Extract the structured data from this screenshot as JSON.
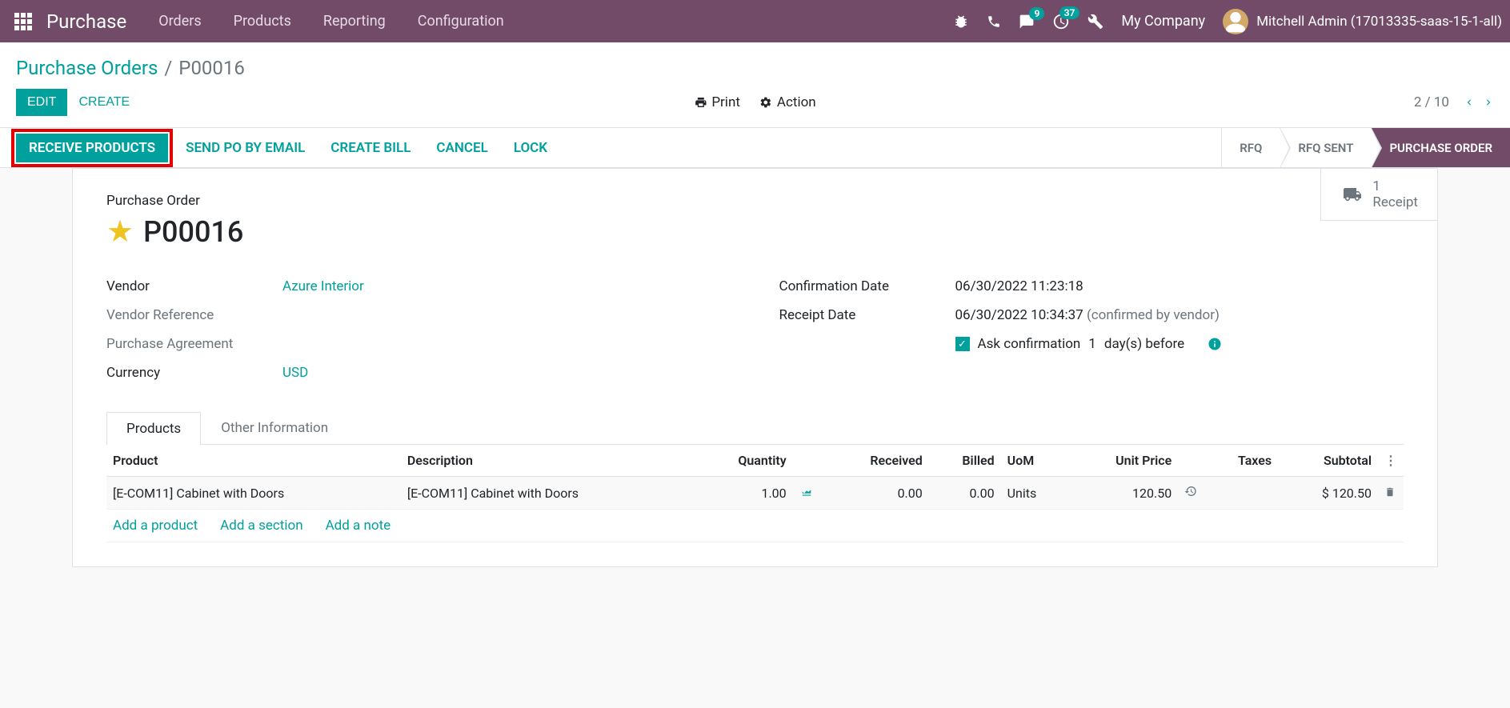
{
  "topnav": {
    "app_name": "Purchase",
    "menu": [
      "Orders",
      "Products",
      "Reporting",
      "Configuration"
    ],
    "msg_badge": "9",
    "activity_badge": "37",
    "company": "My Company",
    "user": "Mitchell Admin (17013335-saas-15-1-all)"
  },
  "breadcrumb": {
    "parent": "Purchase Orders",
    "current": "P00016"
  },
  "control": {
    "edit": "Edit",
    "create": "Create",
    "print": "Print",
    "action": "Action",
    "pager": "2 / 10"
  },
  "statusbar": {
    "buttons": [
      "Receive Products",
      "Send PO by Email",
      "Create Bill",
      "Cancel",
      "Lock"
    ],
    "stages": [
      "RFQ",
      "RFQ SENT",
      "PURCHASE ORDER"
    ]
  },
  "smart": {
    "receipt_count": "1",
    "receipt_label": "Receipt"
  },
  "form": {
    "title_label": "Purchase Order",
    "title_value": "P00016",
    "left": {
      "vendor_label": "Vendor",
      "vendor_value": "Azure Interior",
      "vendor_ref_label": "Vendor Reference",
      "agreement_label": "Purchase Agreement",
      "currency_label": "Currency",
      "currency_value": "USD"
    },
    "right": {
      "confirm_label": "Confirmation Date",
      "confirm_value": "06/30/2022 11:23:18",
      "receipt_label": "Receipt Date",
      "receipt_value": "06/30/2022 10:34:37",
      "receipt_note": "(confirmed by vendor)",
      "ask_confirm": "Ask confirmation",
      "ask_days": "1",
      "ask_suffix": "day(s) before"
    }
  },
  "tabs": [
    "Products",
    "Other Information"
  ],
  "table": {
    "headers": {
      "product": "Product",
      "description": "Description",
      "quantity": "Quantity",
      "received": "Received",
      "billed": "Billed",
      "uom": "UoM",
      "unit_price": "Unit Price",
      "taxes": "Taxes",
      "subtotal": "Subtotal"
    },
    "rows": [
      {
        "product": "[E-COM11] Cabinet with Doors",
        "description": "[E-COM11] Cabinet with Doors",
        "quantity": "1.00",
        "received": "0.00",
        "billed": "0.00",
        "uom": "Units",
        "unit_price": "120.50",
        "subtotal": "$ 120.50"
      }
    ],
    "add_product": "Add a product",
    "add_section": "Add a section",
    "add_note": "Add a note"
  }
}
